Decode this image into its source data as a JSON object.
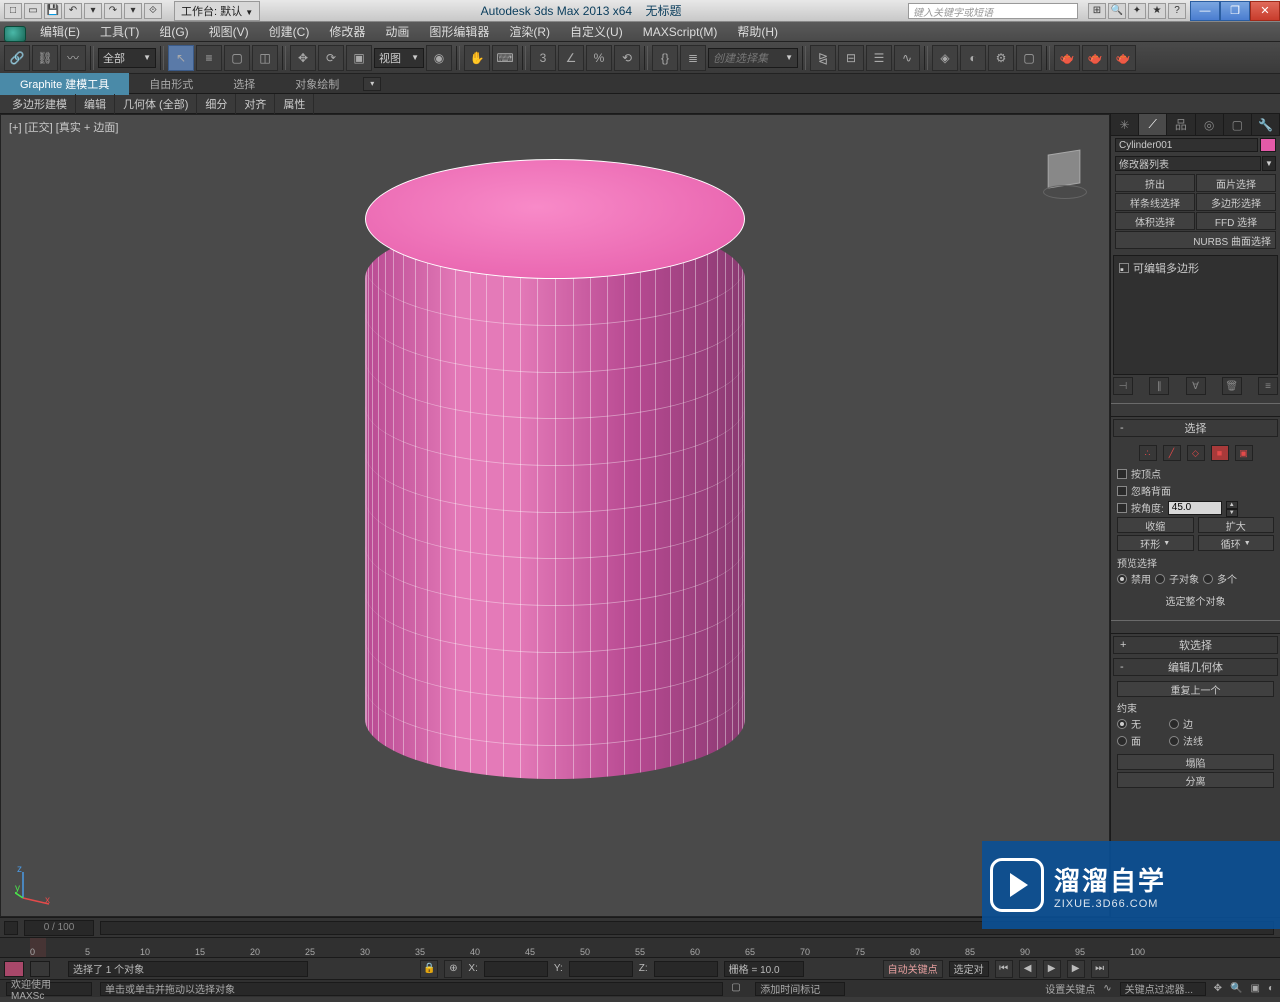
{
  "titlebar": {
    "workspace_label": "工作台: 默认",
    "app_title": "Autodesk 3ds Max  2013 x64",
    "doc_title": "无标题",
    "search_placeholder": "键入关键字或短语"
  },
  "menu": {
    "items": [
      "编辑(E)",
      "工具(T)",
      "组(G)",
      "视图(V)",
      "创建(C)",
      "修改器",
      "动画",
      "图形编辑器",
      "渲染(R)",
      "自定义(U)",
      "MAXScript(M)",
      "帮助(H)"
    ]
  },
  "maintoolbar": {
    "selection_filter": "全部",
    "viewport_dd": "视图",
    "createset_placeholder": "创建选择集"
  },
  "ribbon": {
    "tabs": [
      "Graphite 建模工具",
      "自由形式",
      "选择",
      "对象绘制"
    ],
    "subtabs": [
      "多边形建模",
      "编辑",
      "几何体 (全部)",
      "细分",
      "对齐",
      "属性"
    ]
  },
  "viewport": {
    "label": "[+] [正交] [真实 + 边面]"
  },
  "cmdpanel": {
    "obj_name": "Cylinder001",
    "modlist_label": "修改器列表",
    "mod_buttons": [
      "挤出",
      "面片选择",
      "样条线选择",
      "多边形选择",
      "体积选择",
      "FFD 选择"
    ],
    "mod_buttons_wide": "NURBS 曲面选择",
    "stack_item": "可编辑多边形",
    "roll_select_title": "选择",
    "chk_by_vertex": "按顶点",
    "chk_ignore_back": "忽略背面",
    "by_angle_label": "按角度:",
    "by_angle_value": "45.0",
    "btn_shrink": "收缩",
    "btn_grow": "扩大",
    "btn_ring": "环形",
    "btn_loop": "循环",
    "preview_label": "预览选择",
    "radio_disable": "禁用",
    "radio_subobj": "子对象",
    "radio_multi": "多个",
    "select_whole": "选定整个对象",
    "roll_softsel_title": "软选择",
    "roll_editgeom_title": "编辑几何体",
    "btn_repeat": "重复上一个",
    "constraint_label": "约束",
    "radio_none": "无",
    "radio_edge": "边",
    "radio_face": "面",
    "radio_normal": "法线",
    "btn_collapse": "塌陷",
    "btn_detach": "分离"
  },
  "timeline": {
    "frame_display": "0 / 100",
    "ticks": [
      "0",
      "5",
      "10",
      "15",
      "20",
      "25",
      "30",
      "35",
      "40",
      "45",
      "50",
      "55",
      "60",
      "65",
      "70",
      "75",
      "80",
      "85",
      "90",
      "95",
      "100"
    ]
  },
  "statusbar": {
    "sel_status": "选择了 1 个对象",
    "x_label": "X:",
    "y_label": "Y:",
    "z_label": "Z:",
    "grid_label": "栅格 = 10.0",
    "auto_key": "自动关键点",
    "set_key": "设置关键点",
    "key_filter": "关键点过滤器...",
    "sel_dd": "选定对",
    "welcome": "欢迎使用 MAXSc",
    "hint": "单击或单击并拖动以选择对象",
    "add_time_tag": "添加时间标记"
  },
  "watermark": {
    "big": "溜溜自学",
    "small": "ZIXUE.3D66.COM"
  }
}
